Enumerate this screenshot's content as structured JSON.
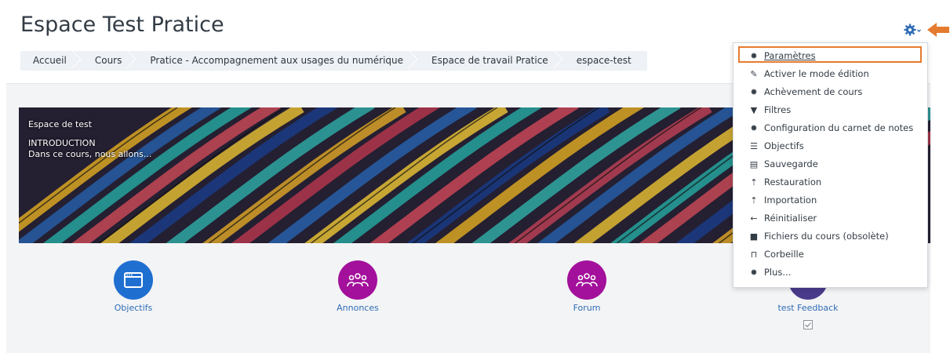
{
  "page": {
    "title": "Espace Test Pratice"
  },
  "breadcrumb": [
    "Accueil",
    "Cours",
    "Pratice - Accompagnement aux usages du numérique",
    "Espace de travail Pratice",
    "espace-test"
  ],
  "banner": {
    "name": "Espace de test",
    "heading": "INTRODUCTION",
    "summary": "Dans ce cours, nous allons..."
  },
  "tiles": [
    {
      "label": "Objectifs",
      "icon": "window-icon",
      "color": "#1f6fd1"
    },
    {
      "label": "Annonces",
      "icon": "users-icon",
      "color": "#a3109b"
    },
    {
      "label": "Forum",
      "icon": "users-icon",
      "color": "#a3109b"
    },
    {
      "label": "test Feedback",
      "icon": "feedback-icon",
      "color": "#4a3a8c"
    }
  ],
  "menu": {
    "items": [
      {
        "label": "Paramètres",
        "icon": "gear-icon",
        "highlighted": true
      },
      {
        "label": "Activer le mode édition",
        "icon": "pencil-icon"
      },
      {
        "label": "Achèvement de cours",
        "icon": "gear-icon"
      },
      {
        "label": "Filtres",
        "icon": "filter-icon"
      },
      {
        "label": "Configuration du carnet de notes",
        "icon": "gear-icon"
      },
      {
        "label": "Objectifs",
        "icon": "list-icon"
      },
      {
        "label": "Sauvegarde",
        "icon": "file-icon"
      },
      {
        "label": "Restauration",
        "icon": "upload-icon"
      },
      {
        "label": "Importation",
        "icon": "upload-icon"
      },
      {
        "label": "Réinitialiser",
        "icon": "arrow-left-icon"
      },
      {
        "label": "Fichiers du cours (obsolète)",
        "icon": "folder-icon"
      },
      {
        "label": "Corbeille",
        "icon": "trash-icon"
      },
      {
        "label": "Plus...",
        "icon": "gear-icon"
      }
    ]
  },
  "colors": {
    "accent": "#1f6fd1",
    "highlight": "#e57b2f",
    "link": "#2f6db5"
  }
}
